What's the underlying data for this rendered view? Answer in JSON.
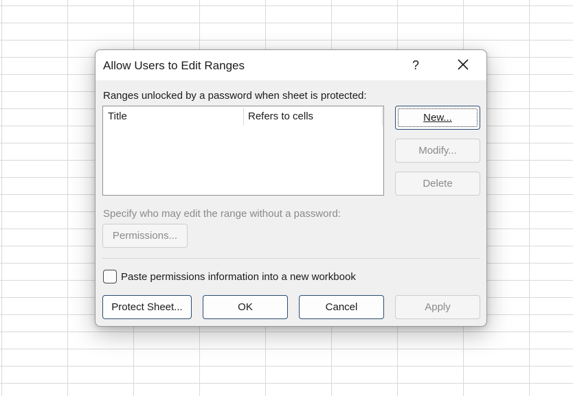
{
  "dialog": {
    "title": "Allow Users to Edit Ranges",
    "help_label": "?",
    "close_icon": "close-icon"
  },
  "ranges": {
    "label": "Ranges unlocked by a password when sheet is protected:",
    "columns": [
      "Title",
      "Refers to cells"
    ],
    "rows": []
  },
  "side_buttons": {
    "new": "New...",
    "modify": "Modify...",
    "delete": "Delete"
  },
  "permissions": {
    "label": "Specify who may edit the range without a password:",
    "button": "Permissions..."
  },
  "paste_option": {
    "label": "Paste permissions information into a new workbook",
    "checked": false
  },
  "footer_buttons": {
    "protect_sheet": "Protect Sheet...",
    "ok": "OK",
    "cancel": "Cancel",
    "apply": "Apply"
  },
  "colors": {
    "default_button_border": "#2b4b72",
    "disabled_text": "#8a8a8a"
  }
}
